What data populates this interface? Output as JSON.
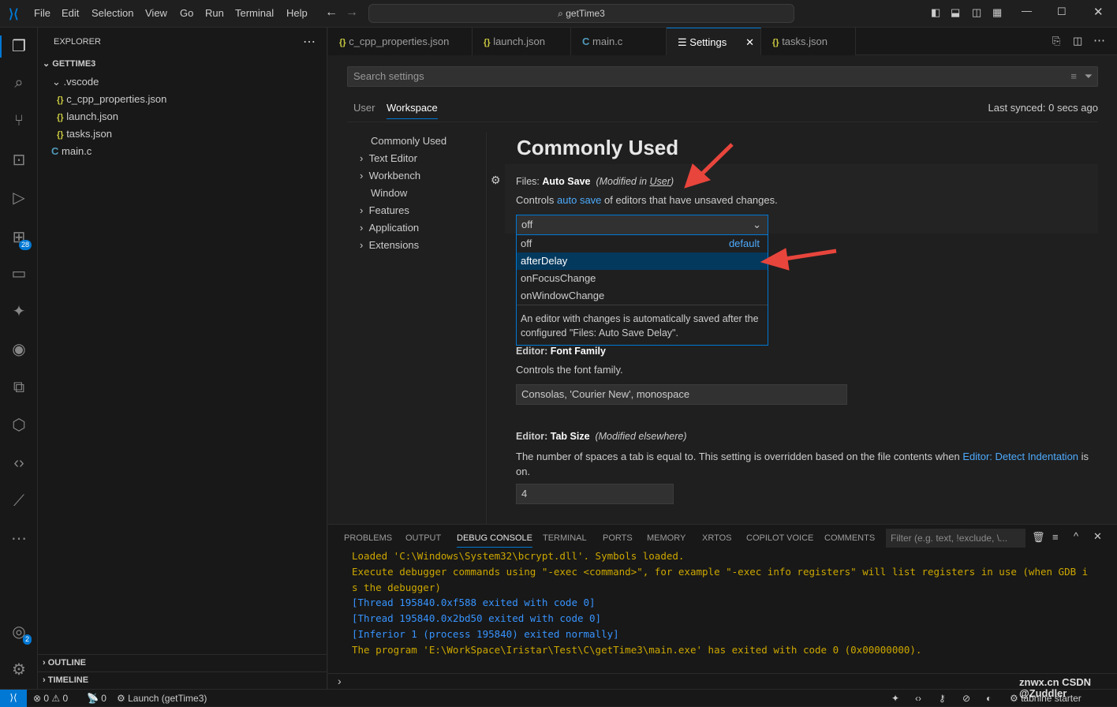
{
  "titlebar": {
    "menus": [
      "File",
      "Edit",
      "Selection",
      "View",
      "Go",
      "Run",
      "Terminal",
      "Help"
    ],
    "command_center": "getTime3"
  },
  "activity": {
    "extensions_badge": "28",
    "accounts_badge": "2"
  },
  "sidebar": {
    "title": "EXPLORER",
    "root": "GETTIME3",
    "folder": ".vscode",
    "files": [
      "c_cpp_properties.json",
      "launch.json",
      "tasks.json"
    ],
    "main_file": "main.c",
    "outline": "OUTLINE",
    "timeline": "TIMELINE"
  },
  "tabs": [
    {
      "label": "c_cpp_properties.json",
      "icon": "{}"
    },
    {
      "label": "launch.json",
      "icon": "{}"
    },
    {
      "label": "main.c",
      "icon": "C"
    },
    {
      "label": "Settings",
      "icon": "settings"
    },
    {
      "label": "tasks.json",
      "icon": "{}"
    }
  ],
  "settings": {
    "search_placeholder": "Search settings",
    "scope_tabs": [
      "User",
      "Workspace"
    ],
    "last_synced": "Last synced: 0 secs ago",
    "toc": [
      "Commonly Used",
      "Text Editor",
      "Workbench",
      "Window",
      "Features",
      "Application",
      "Extensions"
    ],
    "heading": "Commonly Used",
    "autosave": {
      "cat": "Files: ",
      "name": "Auto Save",
      "mod_pre": "(Modified in ",
      "mod_link": "User",
      "mod_post": ")",
      "desc_pre": "Controls ",
      "desc_link": "auto save",
      "desc_post": " of editors that have unsaved changes.",
      "value": "off",
      "options": [
        "off",
        "afterDelay",
        "onFocusChange",
        "onWindowChange"
      ],
      "default_label": "default",
      "option_desc": "An editor with changes is automatically saved after the configured \"Files: Auto Save Delay\"."
    },
    "fontfamily": {
      "cat": "Editor: ",
      "name": "Font Family",
      "desc": "Controls the font family.",
      "value": "Consolas, 'Courier New', monospace"
    },
    "tabsize": {
      "cat": "Editor: ",
      "name": "Tab Size",
      "mod": "(Modified elsewhere)",
      "desc_pre": "The number of spaces a tab is equal to. This setting is overridden based on the file contents when ",
      "desc_link": "Editor: Detect Indentation",
      "desc_post": " is on.",
      "value": "4"
    }
  },
  "panel": {
    "tabs": [
      "PROBLEMS",
      "OUTPUT",
      "DEBUG CONSOLE",
      "TERMINAL",
      "PORTS",
      "MEMORY",
      "XRTOS",
      "COPILOT VOICE",
      "COMMENTS"
    ],
    "filter_placeholder": "Filter (e.g. text, !exclude, \\...",
    "lines": [
      {
        "text": "Loaded 'C:\\Windows\\System32\\bcrypt.dll'. Symbols loaded.",
        "color": "#cca700"
      },
      {
        "text": "Execute debugger commands using \"-exec <command>\", for example \"-exec info registers\" will list registers in use (when GDB i",
        "color": "#cca700"
      },
      {
        "text": "s the debugger)",
        "color": "#cca700"
      },
      {
        "text": "[Thread 195840.0xf588 exited with code 0]",
        "color": "#3794ff"
      },
      {
        "text": "[Thread 195840.0x2bd50 exited with code 0]",
        "color": "#3794ff"
      },
      {
        "text": "[Inferior 1 (process 195840) exited normally]",
        "color": "#3794ff"
      },
      {
        "text": "The program 'E:\\WorkSpace\\Iristar\\Test\\C\\getTime3\\main.exe' has exited with code 0 (0x00000000).",
        "color": "#cca700"
      }
    ]
  },
  "status": {
    "errors": "0",
    "warnings": "0",
    "ports": "0",
    "launch": "Launch (getTime3)",
    "tabnine": "tabnine starter"
  },
  "watermark": "znwx.cn  CSDN @Zuddler",
  "colors": {
    "accent": "#0078d4",
    "highlight": "#04395e",
    "arrow": "#e8453c"
  }
}
